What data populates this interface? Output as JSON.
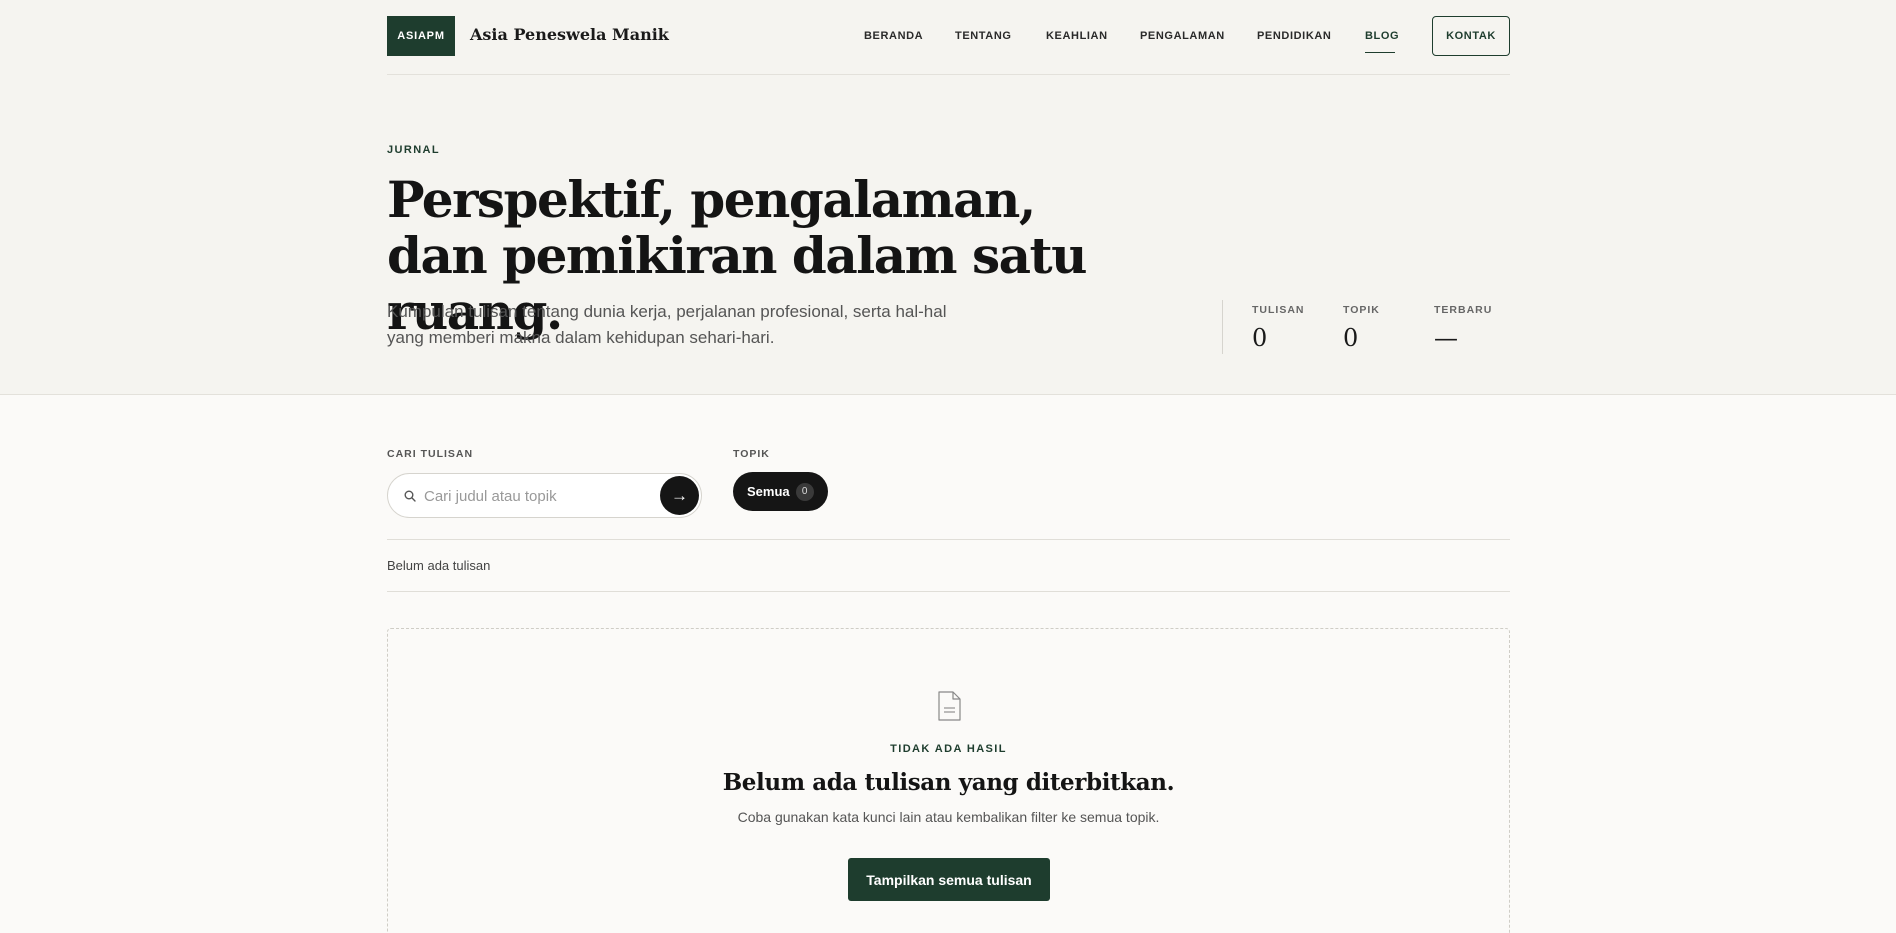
{
  "header": {
    "logo": "ASIAPM",
    "name": "Asia Peneswela Manik",
    "nav": [
      "BERANDA",
      "TENTANG",
      "KEAHLIAN",
      "PENGALAMAN",
      "PENDIDIKAN",
      "BLOG"
    ],
    "active": "BLOG",
    "contact": "KONTAK"
  },
  "hero": {
    "eyebrow": "JURNAL",
    "title": "Perspektif, pengalaman, dan pemikiran dalam satu ruang.",
    "subtitle": "Kumpulan tulisan tentang dunia kerja, perjalanan profesional, serta hal-hal yang memberi makna dalam kehidupan sehari-hari.",
    "stats": [
      {
        "label": "TULISAN",
        "value": "0"
      },
      {
        "label": "TOPIK",
        "value": "0"
      },
      {
        "label": "TERBARU",
        "value": "—"
      }
    ]
  },
  "filters": {
    "search_label": "CARI TULISAN",
    "search_placeholder": "Cari judul atau topik",
    "search_submit": "→",
    "topic_label": "TOPIK",
    "topic_pill": "Semua",
    "topic_count": "0"
  },
  "results": {
    "count_text": "Belum ada tulisan"
  },
  "empty_state": {
    "icon": "document-icon",
    "eyebrow": "TIDAK ADA HASIL",
    "title": "Belum ada tulisan yang diterbitkan.",
    "description": "Coba gunakan kata kunci lain atau kembalikan filter ke semua topik.",
    "button": "Tampilkan semua tulisan"
  },
  "colors": {
    "accent": "#1e3d2e",
    "dark": "#151515",
    "hero_bg": "#f5f4f0",
    "page_bg": "#fbfaf8"
  }
}
